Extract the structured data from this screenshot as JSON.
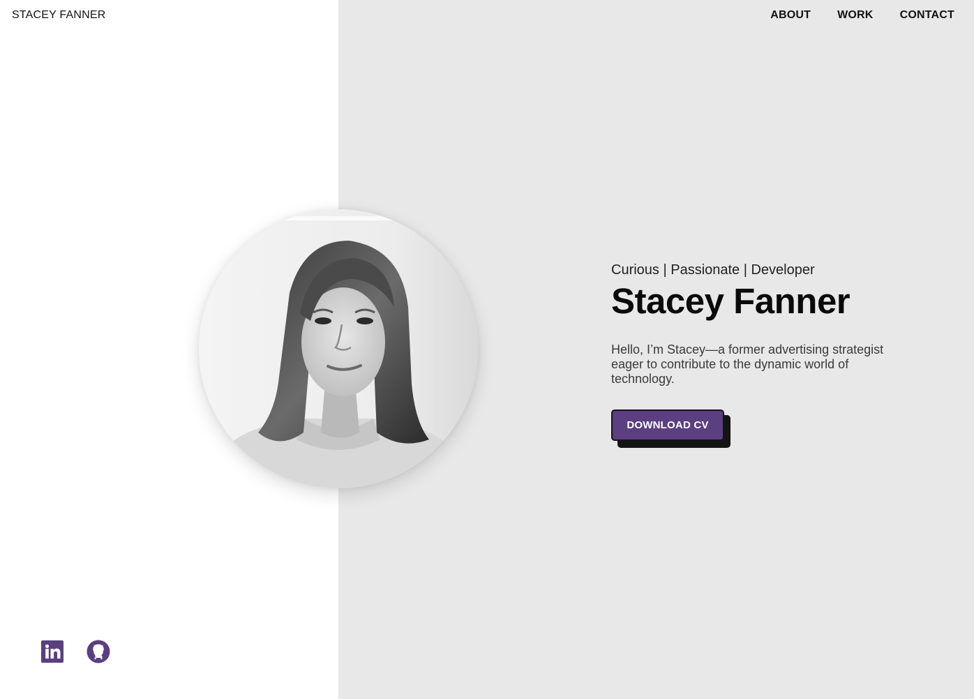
{
  "header": {
    "brand": "STACEY FANNER",
    "nav": [
      {
        "label": "ABOUT"
      },
      {
        "label": "WORK"
      },
      {
        "label": "CONTACT"
      }
    ]
  },
  "hero": {
    "tagline": "Curious | Passionate | Developer",
    "name": "Stacey Fanner",
    "intro": "Hello, I’m Stacey—a former advertising strategist eager to contribute to the dynamic world of technology.",
    "cta_label": "DOWNLOAD CV"
  },
  "social": {
    "items": [
      {
        "icon": "linkedin-icon"
      },
      {
        "icon": "github-icon"
      }
    ]
  },
  "colors": {
    "accent": "#5b3f80",
    "panel": "#e8e8e8",
    "background": "#ffffff"
  }
}
